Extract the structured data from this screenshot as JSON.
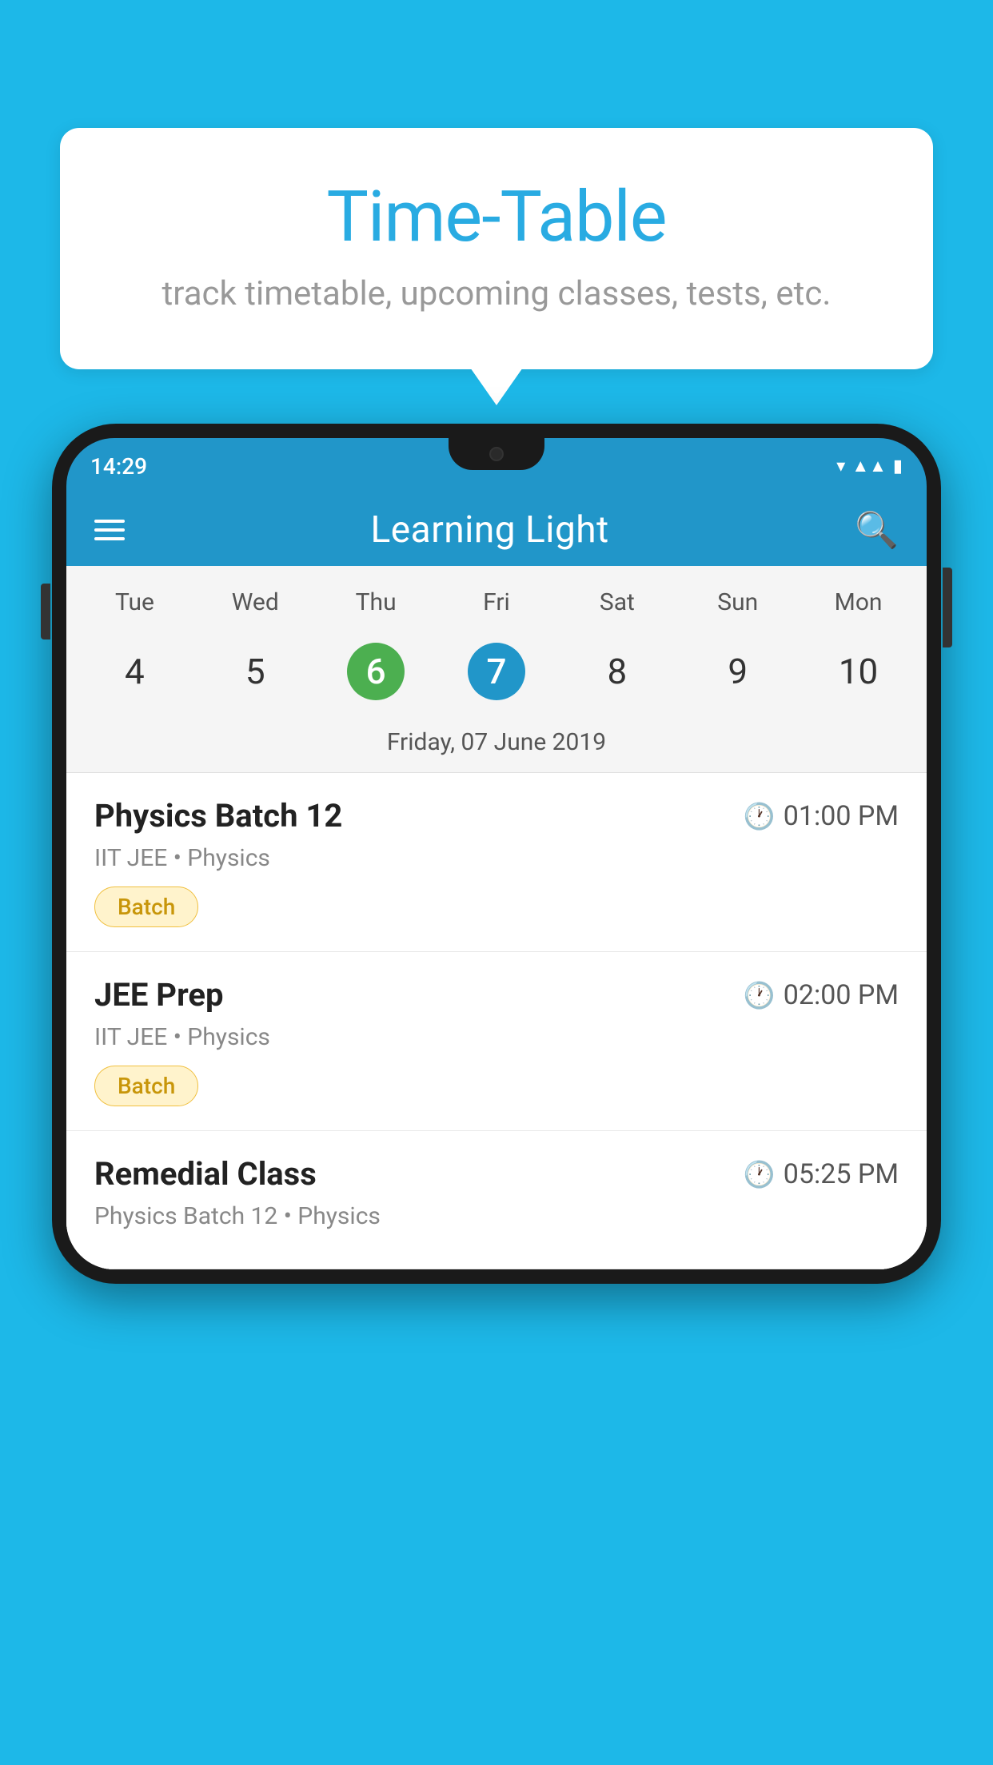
{
  "background_color": "#1DB8E8",
  "speech_bubble": {
    "title": "Time-Table",
    "subtitle": "track timetable, upcoming classes, tests, etc."
  },
  "phone": {
    "status_bar": {
      "time": "14:29"
    },
    "app_header": {
      "title": "Learning Light"
    },
    "calendar": {
      "days": [
        "Tue",
        "Wed",
        "Thu",
        "Fri",
        "Sat",
        "Sun",
        "Mon"
      ],
      "dates": [
        "4",
        "5",
        "6",
        "7",
        "8",
        "9",
        "10"
      ],
      "today_index": 2,
      "selected_index": 3,
      "selected_date_label": "Friday, 07 June 2019"
    },
    "schedule_items": [
      {
        "title": "Physics Batch 12",
        "time": "01:00 PM",
        "subtitle": "IIT JEE • Physics",
        "badge": "Batch"
      },
      {
        "title": "JEE Prep",
        "time": "02:00 PM",
        "subtitle": "IIT JEE • Physics",
        "badge": "Batch"
      },
      {
        "title": "Remedial Class",
        "time": "05:25 PM",
        "subtitle": "Physics Batch 12 • Physics",
        "badge": null
      }
    ]
  }
}
